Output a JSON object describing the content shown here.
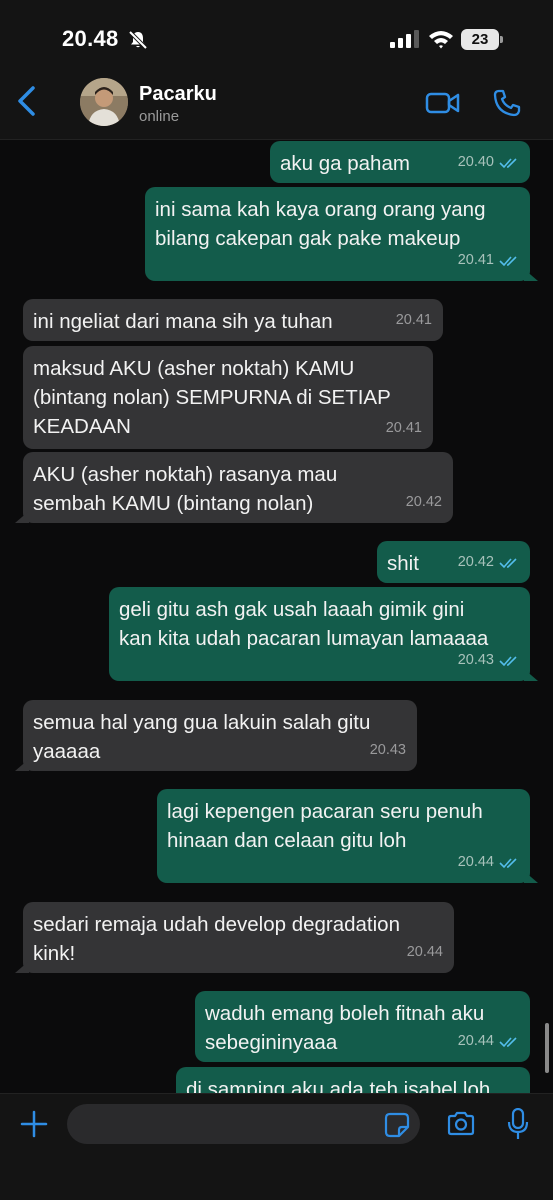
{
  "status_bar": {
    "time": "20.48",
    "battery": "23"
  },
  "header": {
    "contact_name": "Pacarku",
    "contact_status": "online"
  },
  "messages": [
    {
      "direction": "out",
      "text": "aku ga paham",
      "time": "20.40",
      "ticks": "read"
    },
    {
      "direction": "out",
      "text": "ini sama kah kaya orang orang yang\nbilang cakepan gak pake makeup",
      "time": "20.41",
      "ticks": "read"
    },
    {
      "direction": "in",
      "text": "ini ngeliat dari mana sih ya tuhan",
      "time": "20.41"
    },
    {
      "direction": "in",
      "text": "maksud AKU (asher noktah) KAMU\n(bintang nolan) SEMPURNA di SETIAP\nKEADAAN",
      "time": "20.41"
    },
    {
      "direction": "in",
      "text": "AKU (asher noktah) rasanya mau\nsembah KAMU (bintang nolan)",
      "time": "20.42"
    },
    {
      "direction": "out",
      "text": "shit",
      "time": "20.42",
      "ticks": "read"
    },
    {
      "direction": "out",
      "text": "geli gitu ash gak usah laaah gimik gini\nkan kita udah pacaran lumayan lamaaaa",
      "time": "20.43",
      "ticks": "read"
    },
    {
      "direction": "in",
      "text": "semua hal yang gua lakuin salah gitu\nyaaaaa",
      "time": "20.43"
    },
    {
      "direction": "out",
      "text": "lagi kepengen pacaran seru penuh\nhinaan dan celaan gitu loh",
      "time": "20.44",
      "ticks": "read"
    },
    {
      "direction": "in",
      "text": "sedari remaja udah develop degradation\nkink!",
      "time": "20.44"
    },
    {
      "direction": "out",
      "text": "waduh emang boleh fitnah aku\nsebegininyaaa",
      "time": "20.44",
      "ticks": "read"
    },
    {
      "direction": "out",
      "text": "di samping aku ada teh isabel loh",
      "time": "",
      "ticks": ""
    }
  ],
  "input": {
    "placeholder": "",
    "value": ""
  },
  "colors": {
    "outgoing_bubble": "#135c4b",
    "incoming_bubble": "#343436",
    "accent": "#2f8de4",
    "read_ticks": "#53bdeb"
  },
  "icons": [
    "bell-slash-icon",
    "signal-icon",
    "wifi-icon",
    "back-chevron-icon",
    "video-camera-icon",
    "phone-icon",
    "plus-icon",
    "sticker-icon",
    "camera-icon",
    "microphone-icon",
    "double-check-icon"
  ]
}
